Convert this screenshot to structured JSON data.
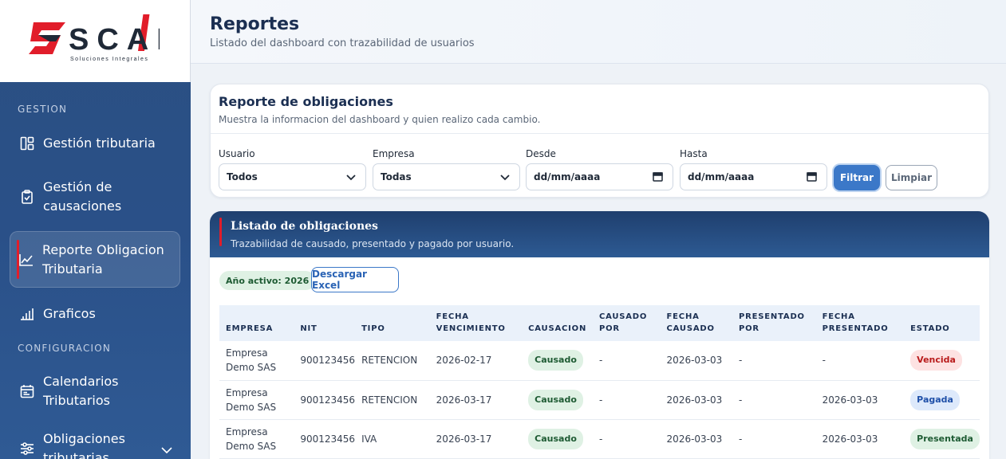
{
  "brand": {
    "name": "SCALA",
    "tagline": "Soluciones Integrales"
  },
  "sidebar": {
    "section_gestion": "GESTION",
    "section_config": "CONFIGURACION",
    "items": [
      {
        "label": "Gestión tributaria",
        "icon": "dashboard-icon"
      },
      {
        "label_line1": "Gestión de",
        "label_line2": "causaciones",
        "icon": "clipboard-check-icon"
      },
      {
        "label_line1": "Reporte Obligacion",
        "label_line2": "Tributaria",
        "icon": "chart-line-icon",
        "active": true
      },
      {
        "label": "Graficos",
        "icon": "bar-chart-icon"
      },
      {
        "label_line1": "Calendarios",
        "label_line2": "Tributarios",
        "icon": "calendar-icon"
      },
      {
        "label_line1": "Obligaciones",
        "label_line2": "tributarias",
        "icon": "sliders-icon"
      }
    ]
  },
  "header": {
    "title": "Reportes",
    "subtitle": "Listado del dashboard con trazabilidad de usuarios"
  },
  "filters": {
    "title": "Reporte de obligaciones",
    "subtitle": "Muestra la informacion del dashboard y quien realizo cada cambio.",
    "usuario_label": "Usuario",
    "usuario_value": "Todos",
    "empresa_label": "Empresa",
    "empresa_value": "Todas",
    "desde_label": "Desde",
    "desde_value": "dd/mm/aaaa",
    "hasta_label": "Hasta",
    "hasta_value": "dd/mm/aaaa",
    "filtrar_label": "Filtrar",
    "limpiar_label": "Limpiar"
  },
  "list": {
    "title": "Listado de obligaciones",
    "subtitle": "Trazabilidad de causado, presentado y pagado por usuario.",
    "year_badge": "Año activo: 2026",
    "excel_label": "Descargar Excel",
    "columns": {
      "empresa": "EMPRESA",
      "nit": "NIT",
      "tipo": "TIPO",
      "fecha_venc_1": "FECHA",
      "fecha_venc_2": "VENCIMIENTO",
      "causacion": "CAUSACION",
      "causado_por_1": "CAUSADO",
      "causado_por_2": "POR",
      "fecha_causado_1": "FECHA",
      "fecha_causado_2": "CAUSADO",
      "presentado_por_1": "PRESENTADO",
      "presentado_por_2": "POR",
      "fecha_presentado_1": "FECHA",
      "fecha_presentado_2": "PRESENTADO",
      "estado": "ESTADO"
    },
    "rows": [
      {
        "empresa_1": "Empresa",
        "empresa_2": "Demo SAS",
        "nit": "900123456",
        "tipo": "RETENCION",
        "vencimiento": "2026-02-17",
        "causacion": "Causado",
        "causado_por": "-",
        "fecha_causado": "2026-03-03",
        "presentado_por": "-",
        "fecha_presentado": "-",
        "estado": "Vencida"
      },
      {
        "empresa_1": "Empresa",
        "empresa_2": "Demo SAS",
        "nit": "900123456",
        "tipo": "RETENCION",
        "vencimiento": "2026-03-17",
        "causacion": "Causado",
        "causado_por": "-",
        "fecha_causado": "2026-03-03",
        "presentado_por": "-",
        "fecha_presentado": "2026-03-03",
        "estado": "Pagada"
      },
      {
        "empresa_1": "Empresa",
        "empresa_2": "Demo SAS",
        "nit": "900123456",
        "tipo": "IVA",
        "vencimiento": "2026-03-17",
        "causacion": "Causado",
        "causado_por": "-",
        "fecha_causado": "2026-03-03",
        "presentado_por": "-",
        "fecha_presentado": "2026-03-03",
        "estado": "Presentada"
      }
    ]
  },
  "colors": {
    "accent": "#3b78c8",
    "brand_red": "#e11d2a",
    "sidebar": "#2b4f82"
  }
}
